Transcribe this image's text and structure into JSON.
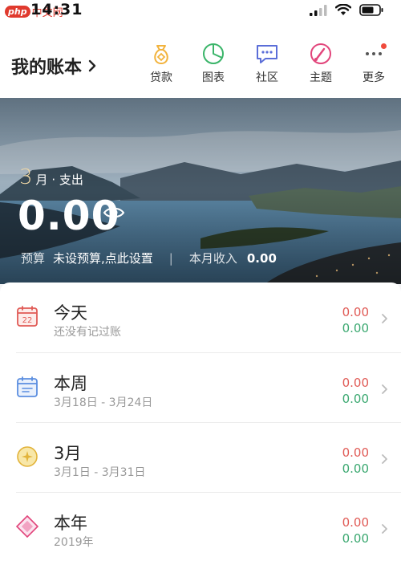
{
  "status": {
    "logo_badge": "php",
    "logo_text": "中文网",
    "time": "14:31"
  },
  "header": {
    "title": "我的账本",
    "nav": [
      {
        "label": "贷款",
        "icon": "loan-icon",
        "color": "#f2b33d"
      },
      {
        "label": "图表",
        "icon": "chart-icon",
        "color": "#3bb56a"
      },
      {
        "label": "社区",
        "icon": "community-icon",
        "color": "#5b6ed8"
      },
      {
        "label": "主题",
        "icon": "theme-icon",
        "color": "#e2457b"
      },
      {
        "label": "更多",
        "icon": "more-icon",
        "color": "#555555"
      }
    ]
  },
  "hero": {
    "month_num": "3",
    "month_suffix": "月 · 支出",
    "expense": "0.00",
    "budget_label": "预算",
    "budget_status": "未设预算,点此设置",
    "separator": "|",
    "income_label": "本月收入",
    "income_value": "0.00"
  },
  "periods": [
    {
      "title": "今天",
      "subtitle": "还没有记过账",
      "expense": "0.00",
      "income": "0.00",
      "icon": "calendar-day-icon",
      "icon_text": "22"
    },
    {
      "title": "本周",
      "subtitle": "3月18日 - 3月24日",
      "expense": "0.00",
      "income": "0.00",
      "icon": "calendar-week-icon"
    },
    {
      "title": "3月",
      "subtitle": "3月1日 - 3月31日",
      "expense": "0.00",
      "income": "0.00",
      "icon": "moon-icon"
    },
    {
      "title": "本年",
      "subtitle": "2019年",
      "expense": "0.00",
      "income": "0.00",
      "icon": "diamond-icon"
    }
  ],
  "colors": {
    "expense": "#e05a55",
    "income": "#3aa870",
    "accent_gold": "#f0d8a6"
  }
}
